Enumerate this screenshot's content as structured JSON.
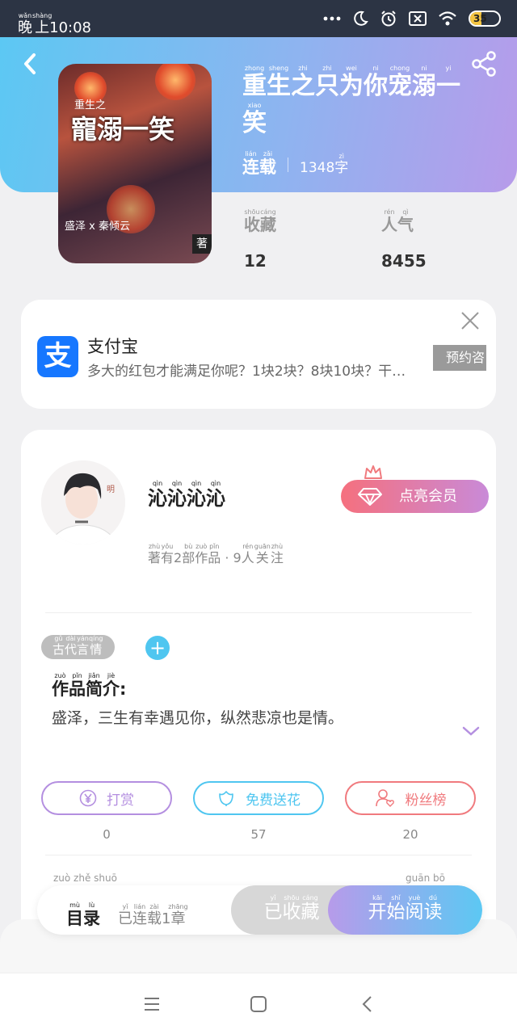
{
  "status_bar": {
    "time_prefix": "晚上",
    "time_prefix_pinyin_1": "wǎn",
    "time_prefix_pinyin_2": "shàng",
    "time": "10:08",
    "battery": "35"
  },
  "book": {
    "title_chars": [
      {
        "char": "重",
        "pinyin": "zhong"
      },
      {
        "char": "生",
        "pinyin": "sheng"
      },
      {
        "char": "之",
        "pinyin": "zhi"
      },
      {
        "char": "只",
        "pinyin": "zhi"
      },
      {
        "char": "为",
        "pinyin": "wei"
      },
      {
        "char": "你",
        "pinyin": "ni"
      },
      {
        "char": "宠",
        "pinyin": "chong"
      },
      {
        "char": "溺",
        "pinyin": "ni"
      },
      {
        "char": "一",
        "pinyin": "yi"
      },
      {
        "char": "笑",
        "pinyin": "xiao"
      }
    ],
    "status": "连载",
    "status_pinyin": [
      "lián",
      "zǎi"
    ],
    "word_count": "1348",
    "word_unit": "字",
    "word_unit_pinyin": "zì",
    "cover": {
      "title_small": "重生之",
      "title_large": "寵溺一笑",
      "authors": "盛泽 x 秦倾云",
      "badge": "著"
    }
  },
  "stats": {
    "favorites_label": "收藏",
    "favorites_pinyin": [
      "shōu",
      "cáng"
    ],
    "favorites_value": "12",
    "popularity_label": "人气",
    "popularity_pinyin": [
      "rén",
      "qì"
    ],
    "popularity_value": "8455"
  },
  "ad": {
    "logo_char": "支",
    "title": "支付宝",
    "description": "多大的红包才能满足你呢？1块2块？8块10块？干…",
    "cta": "预约咨"
  },
  "author": {
    "name": "沁沁沁沁",
    "name_pinyin": "qìn",
    "works_prefix": "著有",
    "works_prefix_pinyin": [
      "zhù",
      "yǒu"
    ],
    "works_count": "2",
    "works_suffix": "部作品",
    "works_suffix_pinyin": [
      "bù",
      "zuò",
      "pǐn"
    ],
    "separator": "·",
    "followers_count": "9",
    "followers_suffix": "人关注",
    "followers_suffix_pinyin": [
      "rén",
      "guān",
      "zhù"
    ],
    "vip_label": "点亮会员"
  },
  "tags": {
    "genre": "古代言情",
    "genre_pinyin": [
      "gǔ",
      "dài",
      "yán",
      "qíng"
    ],
    "add_symbol": "+"
  },
  "intro": {
    "title": "作品简介:",
    "title_pinyin": [
      "zuò",
      "pǐn",
      "jiǎn",
      "jiè"
    ],
    "text": "盛泽，三生有幸遇见你，纵然悲凉也是情。"
  },
  "actions": [
    {
      "label": "打赏",
      "count": "0",
      "color": "#b48fe0"
    },
    {
      "label": "免费送花",
      "count": "57",
      "color": "#4fc6f0"
    },
    {
      "label": "粉丝榜",
      "count": "20",
      "color": "#f07a7e"
    }
  ],
  "faded_row": {
    "left": "zuò zhě shuō",
    "right": "guān bō"
  },
  "bottom_bar": {
    "toc_label": "目录",
    "toc_pinyin": [
      "mù",
      "lù"
    ],
    "toc_sub": "已连载1章",
    "toc_sub_pinyin": [
      "yǐ",
      "lián",
      "zài",
      "",
      "zhāng"
    ],
    "collect_label": "已收藏",
    "collect_pinyin": [
      "yǐ",
      "shōu",
      "cáng"
    ],
    "read_label": "开始阅读",
    "read_pinyin": [
      "kāi",
      "shǐ",
      "yuè",
      "dú"
    ]
  },
  "colors": {
    "header_gradient_start": "#5cc8f3",
    "header_gradient_end": "#b79bea",
    "vip_gradient_start": "#f5707e",
    "vip_gradient_end": "#c98ad8",
    "alipay_blue": "#1677ff"
  },
  "icons": {
    "back": "chevron-left-icon",
    "share": "share-icon",
    "close": "close-icon",
    "crown": "crown-icon",
    "diamond": "diamond-icon",
    "expand": "chevron-down-icon",
    "reward": "yen-icon",
    "flower": "flower-icon",
    "fans": "user-heart-icon"
  }
}
